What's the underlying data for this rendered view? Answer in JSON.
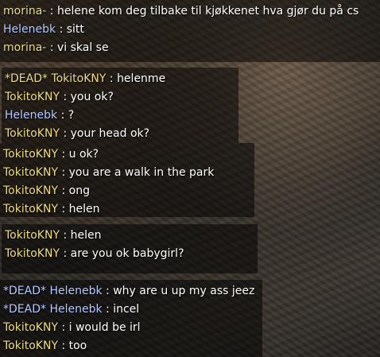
{
  "colors": {
    "ct_name": "#b3c9ff",
    "t_name": "#eedc8a",
    "message": "#ffffff",
    "block_bg": "rgba(0,0,0,0.52)"
  },
  "blocks": [
    {
      "lines": [
        {
          "prefix": "",
          "name": "morina-",
          "team": "t",
          "message": "helene kom deg tilbake til kjøkkenet hva gjør du på cs"
        },
        {
          "prefix": "",
          "name": "Helenebk",
          "team": "ct",
          "message": "sitt"
        },
        {
          "prefix": "",
          "name": "morina-",
          "team": "t",
          "message": "vi skal se"
        }
      ]
    },
    {
      "lines": [
        {
          "prefix": "*DEAD* ",
          "name": "TokitoKNY",
          "team": "t",
          "message": "helenme"
        },
        {
          "prefix": "",
          "name": "TokitoKNY",
          "team": "t",
          "message": "you ok?"
        },
        {
          "prefix": "",
          "name": "Helenebk",
          "team": "ct",
          "message": "?"
        },
        {
          "prefix": "",
          "name": "TokitoKNY",
          "team": "t",
          "message": "your head ok?"
        }
      ]
    },
    {
      "lines": [
        {
          "prefix": "",
          "name": "TokitoKNY",
          "team": "t",
          "message": "u ok?"
        },
        {
          "prefix": "",
          "name": "TokitoKNY",
          "team": "t",
          "message": "you are a walk in the park"
        },
        {
          "prefix": "",
          "name": "TokitoKNY",
          "team": "t",
          "message": "ong"
        },
        {
          "prefix": "",
          "name": "TokitoKNY",
          "team": "t",
          "message": "helen"
        }
      ]
    },
    {
      "lines": [
        {
          "prefix": "",
          "name": "TokitoKNY",
          "team": "t",
          "message": "helen"
        },
        {
          "prefix": "",
          "name": "TokitoKNY",
          "team": "t",
          "message": "are you ok babygirl?"
        }
      ]
    },
    {
      "lines": [
        {
          "prefix": "*DEAD* ",
          "name": "Helenebk",
          "team": "ct",
          "message": "why are u up my ass jeez"
        },
        {
          "prefix": "*DEAD* ",
          "name": "Helenebk",
          "team": "ct",
          "message": "incel"
        },
        {
          "prefix": "",
          "name": "TokitoKNY",
          "team": "t",
          "message": "i would be irl"
        },
        {
          "prefix": "",
          "name": "TokitoKNY",
          "team": "t",
          "message": "too"
        }
      ]
    }
  ]
}
